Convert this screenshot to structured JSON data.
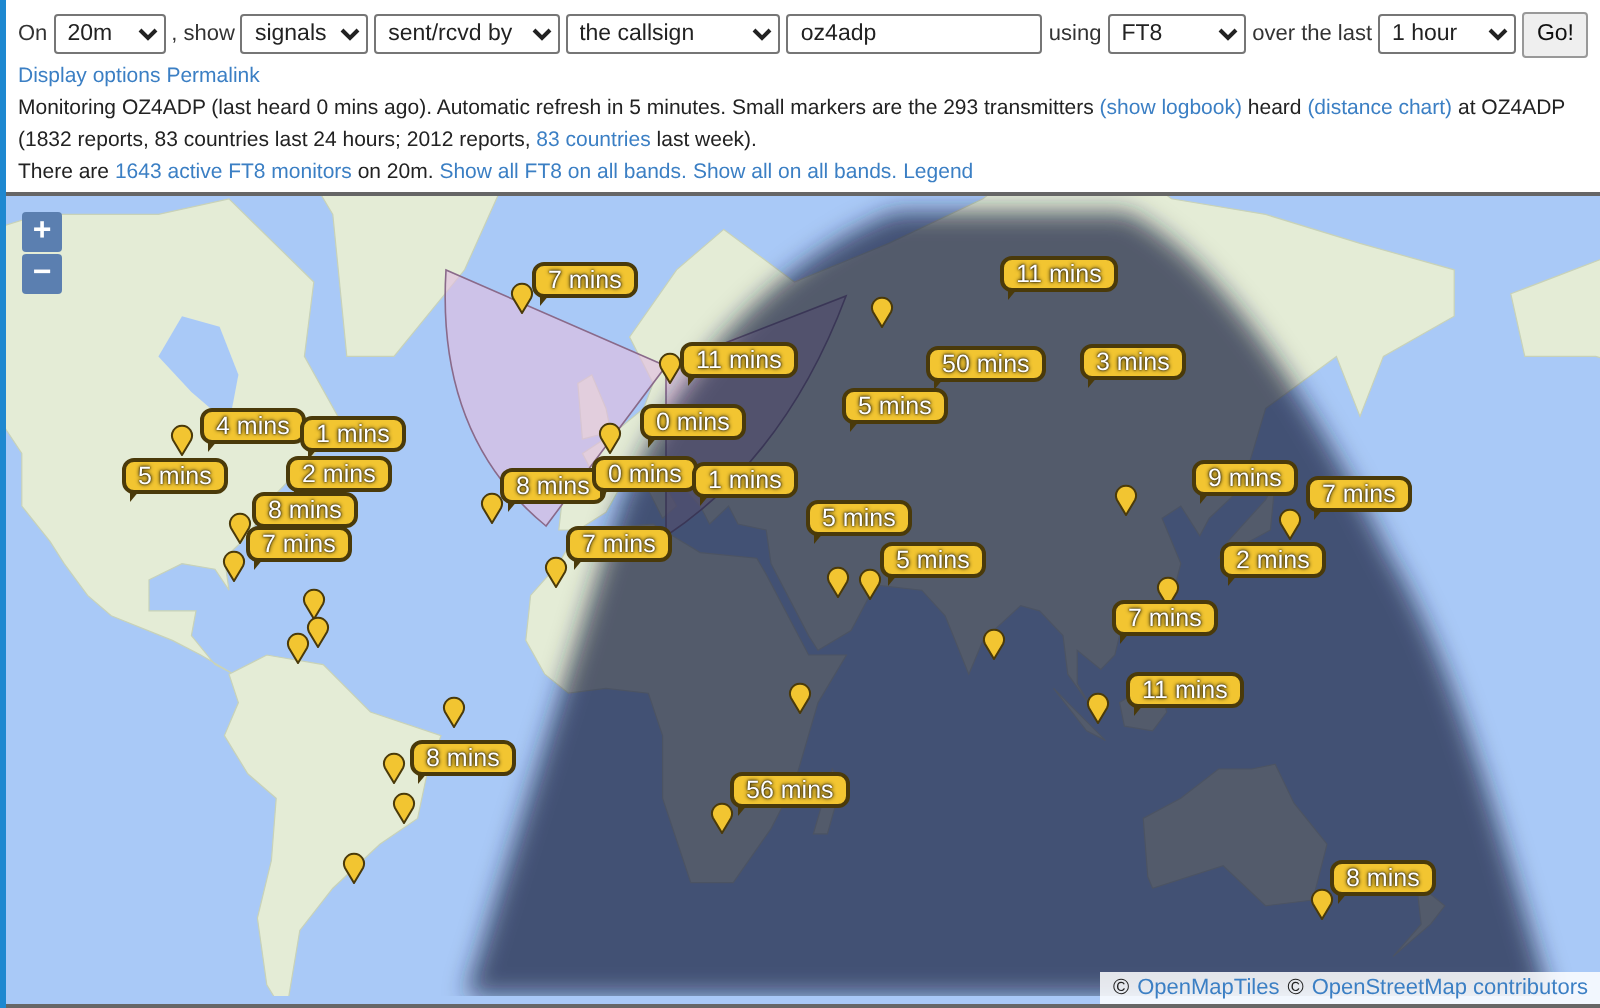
{
  "form": [
    {
      "kind": "text",
      "text": "On"
    },
    {
      "kind": "select",
      "value": "20m"
    },
    {
      "kind": "text",
      "text": ", show"
    },
    {
      "kind": "select",
      "value": "signals"
    },
    {
      "kind": "select",
      "value": "sent/rcvd by"
    },
    {
      "kind": "select",
      "value": "the callsign"
    },
    {
      "kind": "input",
      "value": "oz4adp"
    },
    {
      "kind": "text",
      "text": "using"
    },
    {
      "kind": "select",
      "value": "FT8"
    },
    {
      "kind": "text",
      "text": "over the last"
    },
    {
      "kind": "select",
      "value": "1 hour"
    },
    {
      "kind": "button",
      "text": "Go!"
    }
  ],
  "option_links": [
    "Display options",
    "Permalink"
  ],
  "status": [
    {
      "kind": "text",
      "text": "Monitoring OZ4ADP (last heard 0 mins ago). Automatic refresh in 5 minutes. Small markers are the 293 transmitters "
    },
    {
      "kind": "link",
      "text": "(show logbook)"
    },
    {
      "kind": "text",
      "text": " heard "
    },
    {
      "kind": "link",
      "text": "(distance chart)"
    },
    {
      "kind": "text",
      "text": " at OZ4ADP (1832 reports, 83 countries last 24 hours; 2012 reports, "
    },
    {
      "kind": "link",
      "text": "83 countries"
    },
    {
      "kind": "text",
      "text": " last week)."
    }
  ],
  "monitors": [
    {
      "kind": "text",
      "text": "There are "
    },
    {
      "kind": "link",
      "text": "1643 active FT8 monitors"
    },
    {
      "kind": "text",
      "text": " on 20m. "
    },
    {
      "kind": "link",
      "text": "Show all FT8 on all bands."
    },
    {
      "kind": "link",
      "text": "Show all on all bands."
    },
    {
      "kind": "link",
      "text": "Legend"
    }
  ],
  "map": {
    "zoom_controls": [
      "+",
      "−"
    ],
    "callouts": [
      {
        "text": "7 mins"
      },
      {
        "text": "11 mins"
      },
      {
        "text": "4 mins"
      },
      {
        "text": "1 mins"
      },
      {
        "text": "5 mins"
      },
      {
        "text": "2 mins"
      },
      {
        "text": "8 mins"
      },
      {
        "text": "7 mins"
      },
      {
        "text": "8 mins"
      },
      {
        "text": "7 mins"
      },
      {
        "text": "11 mins"
      },
      {
        "text": "0 mins"
      },
      {
        "text": "0 mins"
      },
      {
        "text": "1 mins"
      },
      {
        "text": "5 mins"
      },
      {
        "text": "50 mins"
      },
      {
        "text": "3 mins"
      },
      {
        "text": "5 mins"
      },
      {
        "text": "9 mins"
      },
      {
        "text": "7 mins"
      },
      {
        "text": "2 mins"
      },
      {
        "text": "7 mins"
      },
      {
        "text": "5 mins"
      },
      {
        "text": "11 mins"
      },
      {
        "text": "56 mins"
      },
      {
        "text": "8 mins"
      },
      {
        "text": "8 mins"
      }
    ],
    "attribution": [
      {
        "kind": "text",
        "text": "©"
      },
      {
        "kind": "link",
        "text": "OpenMapTiles"
      },
      {
        "kind": "text",
        "text": "©"
      },
      {
        "kind": "link",
        "text": "OpenStreetMap contributors"
      }
    ]
  }
}
